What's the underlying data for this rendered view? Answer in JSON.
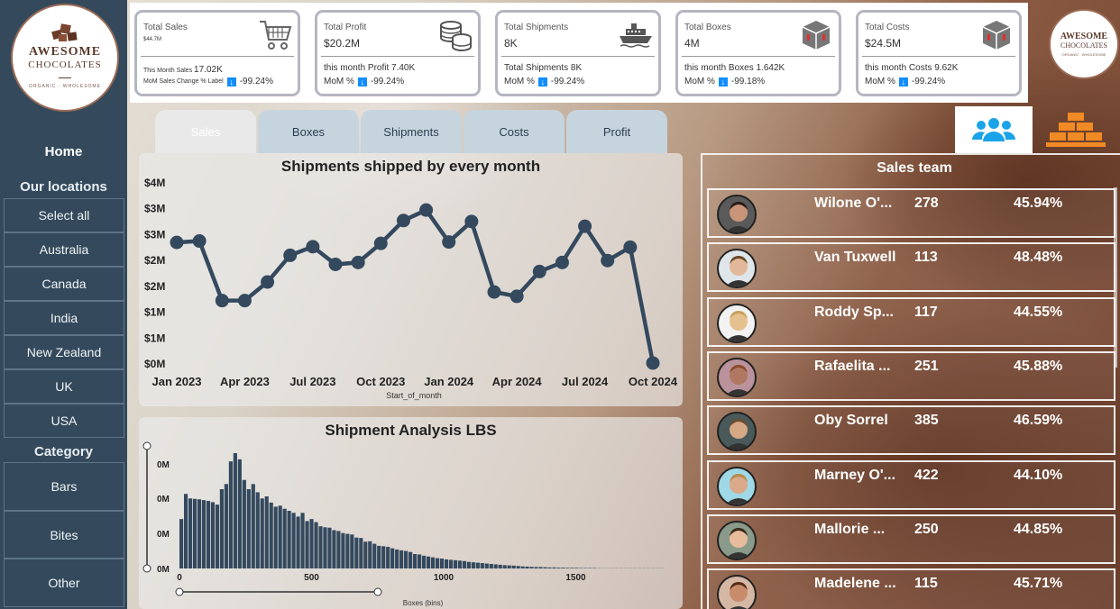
{
  "brand": {
    "line1": "AWESOME",
    "line2": "CHOCOLATES",
    "tagline": "ORGANIC · WHOLESOME"
  },
  "sidebar": {
    "home": "Home",
    "locations_title": "Our locations",
    "locations": [
      "Select all",
      "Australia",
      "Canada",
      "India",
      "New Zealand",
      "UK",
      "USA"
    ],
    "category_title": "Category",
    "categories": [
      "Bars",
      "Bites",
      "Other"
    ]
  },
  "kpis": {
    "sales": {
      "title": "Total Sales",
      "value": "$44.7M",
      "sub_label": "This Month Sales",
      "sub_value": "17.02K",
      "mom_label": "MoM Sales Change % Label",
      "mom_value": "-99.24%",
      "icon": "shopping-cart-icon"
    },
    "profit": {
      "title": "Total Profit",
      "value": "$20.2M",
      "sub": "this month Profit 7.40K",
      "mom_label": "MoM %",
      "mom_value": "-99.24%",
      "icon": "coins-icon"
    },
    "shipments": {
      "title": "Total Shipments",
      "value": "8K",
      "sub": "Total Shipments 8K",
      "mom_label": "MoM %",
      "mom_value": "-99.24%",
      "icon": "ship-icon"
    },
    "boxes": {
      "title": "Total Boxes",
      "value": "4M",
      "sub": "this month Boxes 1.642K",
      "mom_label": "MoM %",
      "mom_value": "-99.18%",
      "icon": "box-icon"
    },
    "costs": {
      "title": "Total Costs",
      "value": "$24.5M",
      "sub": "this month Costs 9.62K",
      "mom_label": "MoM %",
      "mom_value": "-99.24%",
      "icon": "box-icon"
    }
  },
  "tabs": [
    "Sales",
    "Boxes",
    "Shipments",
    "Costs",
    "Profit"
  ],
  "colors": {
    "sidebar": "#344a5c",
    "line": "#34495e",
    "accent": "#118dff",
    "team_icon": "#1aa3e8",
    "bricks_icon": "#f08a24"
  },
  "chart_data": [
    {
      "type": "line",
      "title": "Shipments shipped by every month",
      "xlabel": "Start_of_month",
      "ylabel": "",
      "ytick_labels": [
        "$0M",
        "$1M",
        "$1M",
        "$2M",
        "$2M",
        "$3M",
        "$3M",
        "$4M"
      ],
      "ylim": [
        0,
        3.8
      ],
      "xtick_labels": [
        "Jan 2023",
        "Apr 2023",
        "Jul 2023",
        "Oct 2023",
        "Jan 2024",
        "Apr 2024",
        "Jul 2024",
        "Oct 2024"
      ],
      "x": [
        "2023-01",
        "2023-02",
        "2023-03",
        "2023-04",
        "2023-05",
        "2023-06",
        "2023-07",
        "2023-08",
        "2023-09",
        "2023-10",
        "2023-11",
        "2023-12",
        "2024-01",
        "2024-02",
        "2024-03",
        "2024-04",
        "2024-05",
        "2024-06",
        "2024-07",
        "2024-08",
        "2024-09",
        "2024-10"
      ],
      "values": [
        2.55,
        2.58,
        1.33,
        1.33,
        1.72,
        2.28,
        2.46,
        2.09,
        2.13,
        2.53,
        3.01,
        3.23,
        2.56,
        2.99,
        1.51,
        1.42,
        1.94,
        2.13,
        2.89,
        2.17,
        2.45,
        0.02
      ],
      "grid": false
    },
    {
      "type": "bar",
      "title": "Shipment Analysis LBS",
      "xlabel": "Boxes (bins)",
      "ytick_labels": [
        "0M",
        "0M",
        "0M",
        "0M"
      ],
      "xtick_labels": [
        "0",
        "500",
        "1000",
        "1500"
      ],
      "xlim": [
        0,
        1850
      ],
      "bin_width": 17,
      "values": [
        240,
        362,
        340,
        338,
        336,
        332,
        328,
        322,
        310,
        385,
        410,
        520,
        560,
        530,
        430,
        385,
        410,
        370,
        340,
        350,
        320,
        300,
        305,
        290,
        280,
        270,
        252,
        270,
        230,
        240,
        225,
        205,
        200,
        198,
        186,
        182,
        172,
        168,
        165,
        150,
        148,
        130,
        132,
        120,
        110,
        108,
        105,
        98,
        92,
        88,
        85,
        80,
        70,
        68,
        62,
        58,
        54,
        50,
        48,
        44,
        42,
        40,
        38,
        36,
        32,
        30,
        28,
        26,
        24,
        22,
        20,
        18,
        16,
        15,
        14,
        12,
        10,
        9,
        8,
        7,
        7,
        6,
        5,
        5,
        4,
        4,
        3,
        3,
        3,
        2,
        2,
        2,
        2,
        1,
        1,
        1,
        1,
        1,
        1,
        1,
        1,
        1,
        1,
        1,
        1,
        1,
        1,
        1
      ]
    }
  ],
  "sales_team": {
    "title": "Sales team",
    "members": [
      {
        "name": "Wilone O'...",
        "count": "278",
        "pct": "45.94%",
        "avatar": "person-avatar"
      },
      {
        "name": "Van Tuxwell",
        "count": "113",
        "pct": "48.48%",
        "avatar": "person-avatar"
      },
      {
        "name": "Roddy Sp...",
        "count": "117",
        "pct": "44.55%",
        "avatar": "person-avatar"
      },
      {
        "name": "Rafaelita ...",
        "count": "251",
        "pct": "45.88%",
        "avatar": "person-avatar"
      },
      {
        "name": "Oby Sorrel",
        "count": "385",
        "pct": "46.59%",
        "avatar": "person-avatar"
      },
      {
        "name": "Marney O'...",
        "count": "422",
        "pct": "44.10%",
        "avatar": "person-avatar"
      },
      {
        "name": "Mallorie ...",
        "count": "250",
        "pct": "44.85%",
        "avatar": "person-avatar"
      },
      {
        "name": "Madelene ...",
        "count": "115",
        "pct": "45.71%",
        "avatar": "person-avatar"
      }
    ]
  }
}
